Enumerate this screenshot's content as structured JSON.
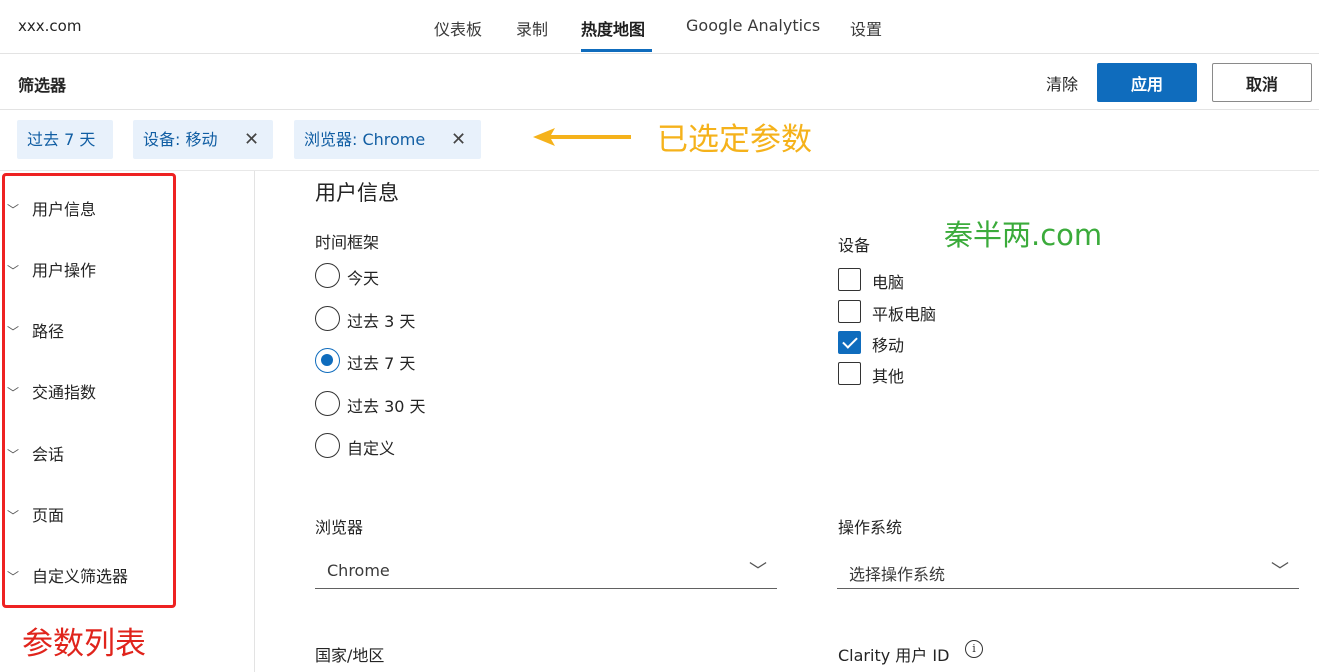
{
  "site": "xxx.com",
  "nav": {
    "items": [
      "仪表板",
      "录制",
      "热度地图",
      "Google Analytics",
      "设置"
    ],
    "active": "热度地图"
  },
  "filter": {
    "title": "筛选器",
    "clear_label": "清除",
    "apply_label": "应用",
    "cancel_label": "取消"
  },
  "chips": [
    {
      "label": "过去 7 天",
      "removable": false
    },
    {
      "label": "设备: 移动",
      "removable": true
    },
    {
      "label": "浏览器: Chrome",
      "removable": true
    }
  ],
  "annotations": {
    "chips_note": "已选定参数",
    "sidebar_note": "参数列表",
    "watermark": "秦半两.com",
    "accent_yellow": "#f5b21b",
    "accent_red": "#e0241c"
  },
  "sidebar": {
    "items": [
      "用户信息",
      "用户操作",
      "路径",
      "交通指数",
      "会话",
      "页面",
      "自定义筛选器"
    ]
  },
  "main": {
    "section_title": "用户信息",
    "time_frame": {
      "label": "时间框架",
      "options": [
        "今天",
        "过去 3 天",
        "过去 7 天",
        "过去 30 天",
        "自定义"
      ],
      "selected": "过去 7 天"
    },
    "device": {
      "label": "设备",
      "options": [
        {
          "label": "电脑",
          "checked": false
        },
        {
          "label": "平板电脑",
          "checked": false
        },
        {
          "label": "移动",
          "checked": true
        },
        {
          "label": "其他",
          "checked": false
        }
      ]
    },
    "browser": {
      "label": "浏览器",
      "value": "Chrome"
    },
    "os": {
      "label": "操作系统",
      "placeholder": "选择操作系统"
    },
    "country": {
      "label": "国家/地区"
    },
    "clarity_id": {
      "label": "Clarity 用户 ID"
    }
  },
  "colors": {
    "primary": "#0f6cbd",
    "chip_bg": "#e8f1fb"
  }
}
